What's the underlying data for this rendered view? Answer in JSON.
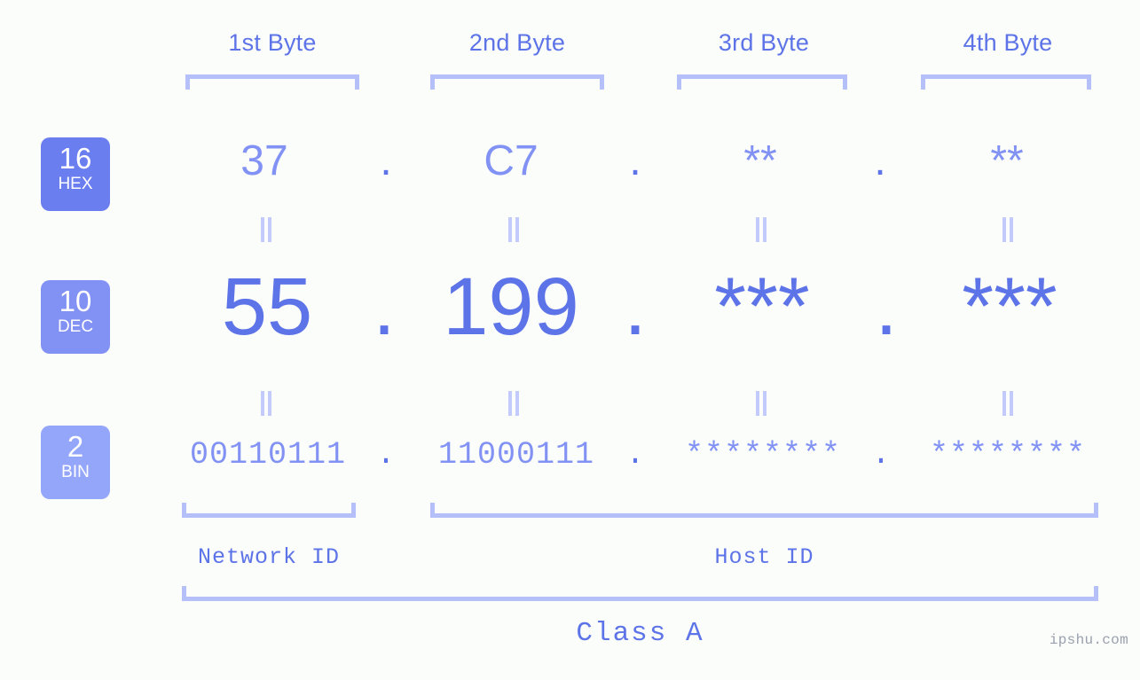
{
  "background_color": "#fbfdfa",
  "accent_colors": {
    "primary": "#5d73e8",
    "secondary": "#8192f4",
    "bracket": "#b5c0fb",
    "equals": "#c2cbfb",
    "badge_hex": "#6b7ef0",
    "badge_dec": "#8191f4",
    "badge_bin": "#94a6f9",
    "watermark": "#9aa0ae"
  },
  "byte_headers": [
    {
      "label": "1st Byte"
    },
    {
      "label": "2nd Byte"
    },
    {
      "label": "3rd Byte"
    },
    {
      "label": "4th Byte"
    }
  ],
  "bases": [
    {
      "number": "16",
      "name": "HEX"
    },
    {
      "number": "10",
      "name": "DEC"
    },
    {
      "number": "2",
      "name": "BIN"
    }
  ],
  "rows": {
    "hex": {
      "base_number": "16",
      "base_name": "HEX",
      "values": [
        "37",
        "C7",
        "**",
        "**"
      ],
      "separators": [
        ".",
        ".",
        "."
      ]
    },
    "dec": {
      "base_number": "10",
      "base_name": "DEC",
      "values": [
        "55",
        "199",
        "***",
        "***"
      ],
      "separators": [
        ".",
        ".",
        "."
      ]
    },
    "bin": {
      "base_number": "2",
      "base_name": "BIN",
      "values": [
        "00110111",
        "11000111",
        "********",
        "********"
      ],
      "separators": [
        ".",
        ".",
        "."
      ]
    }
  },
  "equals_marks": {
    "glyph": "||",
    "count_per_row": 4,
    "rows": 2
  },
  "regions": [
    {
      "label": "Network ID"
    },
    {
      "label": "Host ID"
    }
  ],
  "class": {
    "label": "Class A"
  },
  "watermark": {
    "text": "ipshu.com"
  }
}
